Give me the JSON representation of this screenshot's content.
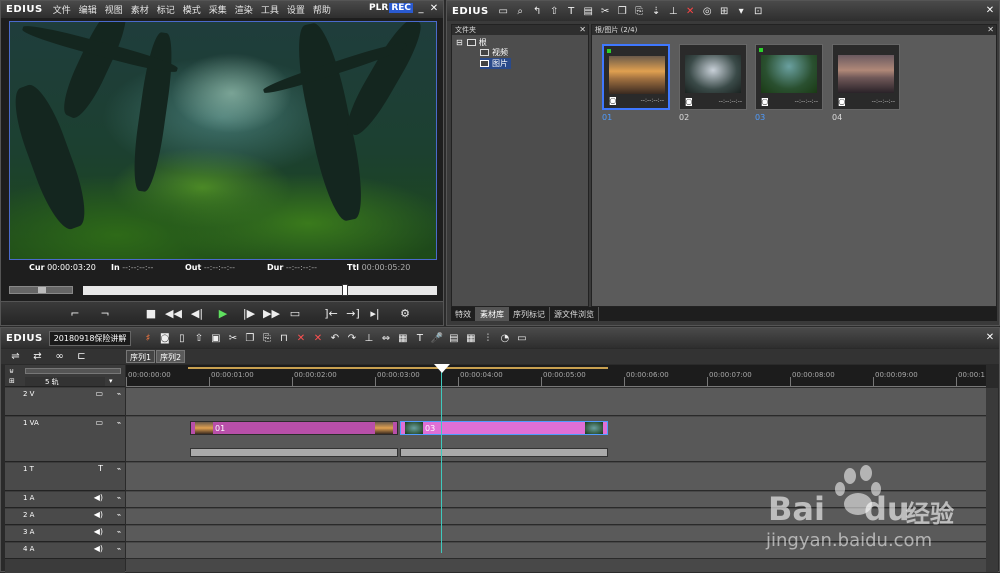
{
  "player": {
    "logo": "EDIUS",
    "menu": [
      "文件",
      "编辑",
      "视图",
      "素材",
      "标记",
      "模式",
      "采集",
      "渲染",
      "工具",
      "设置",
      "帮助"
    ],
    "plr": "PLR",
    "rec": "REC",
    "timecodes": {
      "cur_label": "Cur",
      "cur": "00:00:03:20",
      "in_label": "In",
      "in": "--:--:--:--",
      "out_label": "Out",
      "out": "--:--:--:--",
      "dur_label": "Dur",
      "dur": "--:--:--:--",
      "ttl_label": "Ttl",
      "ttl": "00:00:05:20"
    },
    "scrub_position": 0.74
  },
  "bin": {
    "logo": "EDIUS",
    "tree_title": "文件夹",
    "tree": {
      "root": "根",
      "video": "视频",
      "pictures": "图片"
    },
    "clip_title": "根/图片 (2/4)",
    "clips": [
      {
        "label": "01",
        "duration": "--:--:--:--",
        "selected": true,
        "dot": true
      },
      {
        "label": "02",
        "duration": "--:--:--:--",
        "selected": false,
        "dot": false
      },
      {
        "label": "03",
        "duration": "--:--:--:--",
        "selected": false,
        "dot": true
      },
      {
        "label": "04",
        "duration": "--:--:--:--",
        "selected": false,
        "dot": false
      }
    ],
    "tabs": [
      "特效",
      "素材库",
      "序列标记",
      "源文件浏览"
    ],
    "active_tab": 1
  },
  "timeline": {
    "logo": "EDIUS",
    "project": "20180918保险讲解",
    "sequences": [
      "序列1",
      "序列2"
    ],
    "track_count": "5 轨",
    "ruler": [
      "00:00:00:00",
      "00:00:01:00",
      "00:00:02:00",
      "00:00:03:00",
      "00:00:04:00",
      "00:00:05:00",
      "00:00:06:00",
      "00:00:07:00",
      "00:00:08:00",
      "00:00:09:00",
      "00:00:1"
    ],
    "tracks": [
      {
        "name": "2 V",
        "type": "V"
      },
      {
        "name": "1 VA",
        "type": "VA"
      },
      {
        "name": "1 T",
        "type": "T"
      },
      {
        "name": "1 A",
        "type": "A"
      },
      {
        "name": "2 A",
        "type": "A"
      },
      {
        "name": "3 A",
        "type": "A"
      },
      {
        "name": "4 A",
        "type": "A"
      }
    ],
    "clips": [
      {
        "label": "01",
        "track": "1 VA"
      },
      {
        "label": "03",
        "track": "1 VA"
      }
    ],
    "playhead_time": "00:00:03:20"
  },
  "watermark": {
    "brand": "Bai",
    "brand2": "du",
    "brand_cn": "经验",
    "url": "jingyan.baidu.com"
  }
}
